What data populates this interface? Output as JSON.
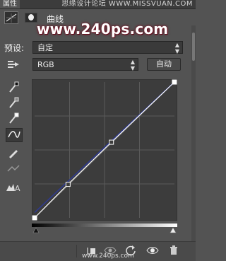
{
  "titlebar": {
    "tab_label": "属性",
    "watermark": "思缘设计论坛 WWW.MISSVUAN.COM"
  },
  "header": {
    "panel_title": "曲线"
  },
  "watermark_site": "www.240ps.com",
  "preset": {
    "label": "预设:",
    "value": "自定"
  },
  "channel": {
    "value": "RGB"
  },
  "auto_button": {
    "label": "自动"
  },
  "icons": {
    "adjustment": "curves-adjustment-icon",
    "mask": "mask-icon",
    "tools": [
      "hand-target-icon",
      "eyedropper-black-icon",
      "eyedropper-gray-icon",
      "eyedropper-white-icon",
      "curve-point-icon",
      "pencil-icon",
      "smooth-icon",
      "clipping-warning-icon"
    ],
    "bottom": [
      "clip-to-layer-icon",
      "view-previous-icon",
      "reset-icon",
      "visibility-eye-icon",
      "trash-icon"
    ]
  },
  "colors": {
    "graph_bg": "#3c3c3c",
    "grid": "#5a5a5a",
    "rgb_curve": "#ffffff",
    "blue_curve": "#2f3a8f",
    "accent": "#ffffff"
  },
  "curves": {
    "rgb_points": [
      [
        0,
        0
      ],
      [
        61,
        63
      ],
      [
        140,
        142
      ],
      [
        255,
        255
      ]
    ],
    "blue_points": [
      [
        0,
        10
      ],
      [
        255,
        255
      ]
    ]
  },
  "footer_site": "www.240ps.com"
}
